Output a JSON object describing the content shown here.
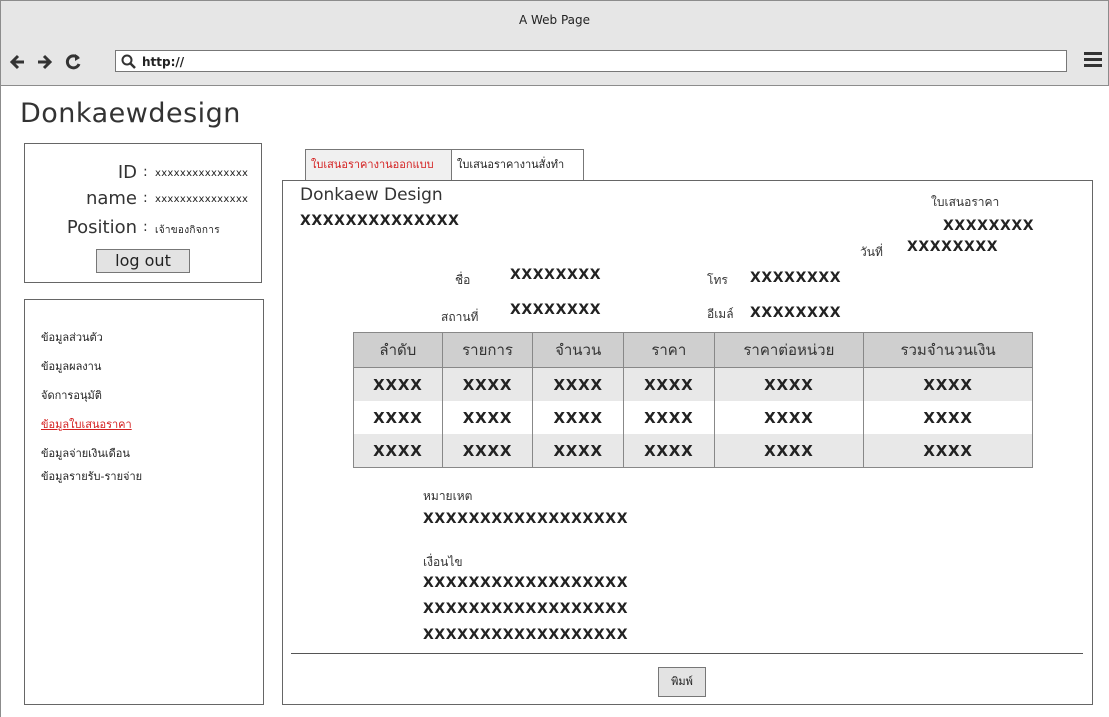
{
  "window": {
    "title": "A Web Page"
  },
  "browser": {
    "url": "http://",
    "back_icon": "arrow-left-icon",
    "forward_icon": "arrow-right-icon",
    "reload_icon": "reload-icon"
  },
  "brand": "Donkaewdesign",
  "profile": {
    "id_label": "ID",
    "id_value": "xxxxxxxxxxxxxxx",
    "name_label": "name",
    "name_value": "xxxxxxxxxxxxxxx",
    "position_label": "Position",
    "position_value": "เจ้าของกิจการ",
    "colon": ":",
    "logout": "log out"
  },
  "menu": {
    "items": [
      {
        "label": "ข้อมูลส่วนตัว"
      },
      {
        "label": "ข้อมูลผลงาน"
      },
      {
        "label": "จัดการอนุมัติ"
      },
      {
        "label": "ข้อมูลใบเสนอราคา",
        "active": true
      },
      {
        "label": "ข้อมูลจ่ายเงินเดือน"
      },
      {
        "label": "ข้อมูลรายรับ-รายจ่าย"
      }
    ]
  },
  "tabs": [
    {
      "label": "ใบเสนอราคางานออกแบบ",
      "active": true
    },
    {
      "label": "ใบเสนอราคางานสั่งทำ"
    }
  ],
  "quote": {
    "company": "Donkaew Design",
    "company_sub": "XXXXXXXXXXXXXX",
    "doc_title": "ใบเสนอราคา",
    "doc_no": "XXXXXXXX",
    "date_label": "วันที่",
    "date_value": "XXXXXXXX",
    "name_label": "ชื่อ",
    "name_value": "XXXXXXXX",
    "phone_label": "โทร",
    "phone_value": "XXXXXXXX",
    "place_label": "สถานที่",
    "place_value": "XXXXXXXX",
    "email_label": "อีเมล์",
    "email_value": "XXXXXXXX",
    "table": {
      "headers": [
        "ลำดับ",
        "รายการ",
        "จำนวน",
        "ราคา",
        "ราคาต่อหน่วย",
        "รวมจำนวนเงิน"
      ],
      "rows": [
        [
          "XXXX",
          "XXXX",
          "XXXX",
          "XXXX",
          "XXXX",
          "XXXX"
        ],
        [
          "XXXX",
          "XXXX",
          "XXXX",
          "XXXX",
          "XXXX",
          "XXXX"
        ],
        [
          "XXXX",
          "XXXX",
          "XXXX",
          "XXXX",
          "XXXX",
          "XXXX"
        ]
      ]
    },
    "note_label": "หมายเหต",
    "note_value": "XXXXXXXXXXXXXXXXXX",
    "conditions_label": "เงื่อนไข",
    "conditions": [
      "XXXXXXXXXXXXXXXXXX",
      "XXXXXXXXXXXXXXXXXX",
      "XXXXXXXXXXXXXXXXXX"
    ],
    "print": "พิมพ์"
  }
}
